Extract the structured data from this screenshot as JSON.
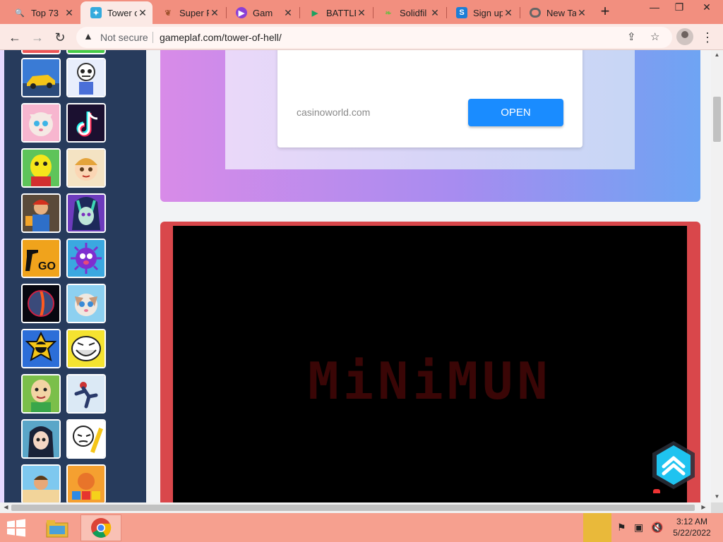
{
  "browser": {
    "tabs": [
      {
        "title": "Top 73",
        "favicon": "search-icon",
        "fav_color": "#f5b31b",
        "active": false
      },
      {
        "title": "Tower o",
        "favicon": "game-icon",
        "fav_color": "#33aadd",
        "active": true
      },
      {
        "title": "Super F",
        "favicon": "bird-icon",
        "fav_color": "#a0522d",
        "active": false
      },
      {
        "title": "Gam",
        "favicon": "play-icon",
        "fav_color": "#8a3fd6",
        "active": false
      },
      {
        "title": "BATTLE",
        "favicon": "play-store-icon",
        "fav_color": "#1aa260",
        "active": false
      },
      {
        "title": "Solidfil",
        "favicon": "leaf-icon",
        "fav_color": "#7ab648",
        "active": false
      },
      {
        "title": "Sign up",
        "favicon": "s-icon",
        "fav_color": "#1c7ed6",
        "active": false
      },
      {
        "title": "New Ta",
        "favicon": "chrome-icon",
        "fav_color": "#666666",
        "active": false
      }
    ],
    "new_tab": "+",
    "security_label": "Not secure",
    "url": "gameplaf.com/tower-of-hell/"
  },
  "ad": {
    "domain": "casinoworld.com",
    "open_label": "OPEN"
  },
  "game": {
    "title": "MiNiMUN"
  },
  "colors": {
    "tab_strip": "#f28f7f",
    "sidebar": "#273b5c",
    "game_frame": "#d9474b",
    "ad_button": "#1a8cff",
    "scroll_top": "#1fc3f0"
  },
  "taskbar": {
    "time": "3:12 AM",
    "date": "5/22/2022"
  }
}
